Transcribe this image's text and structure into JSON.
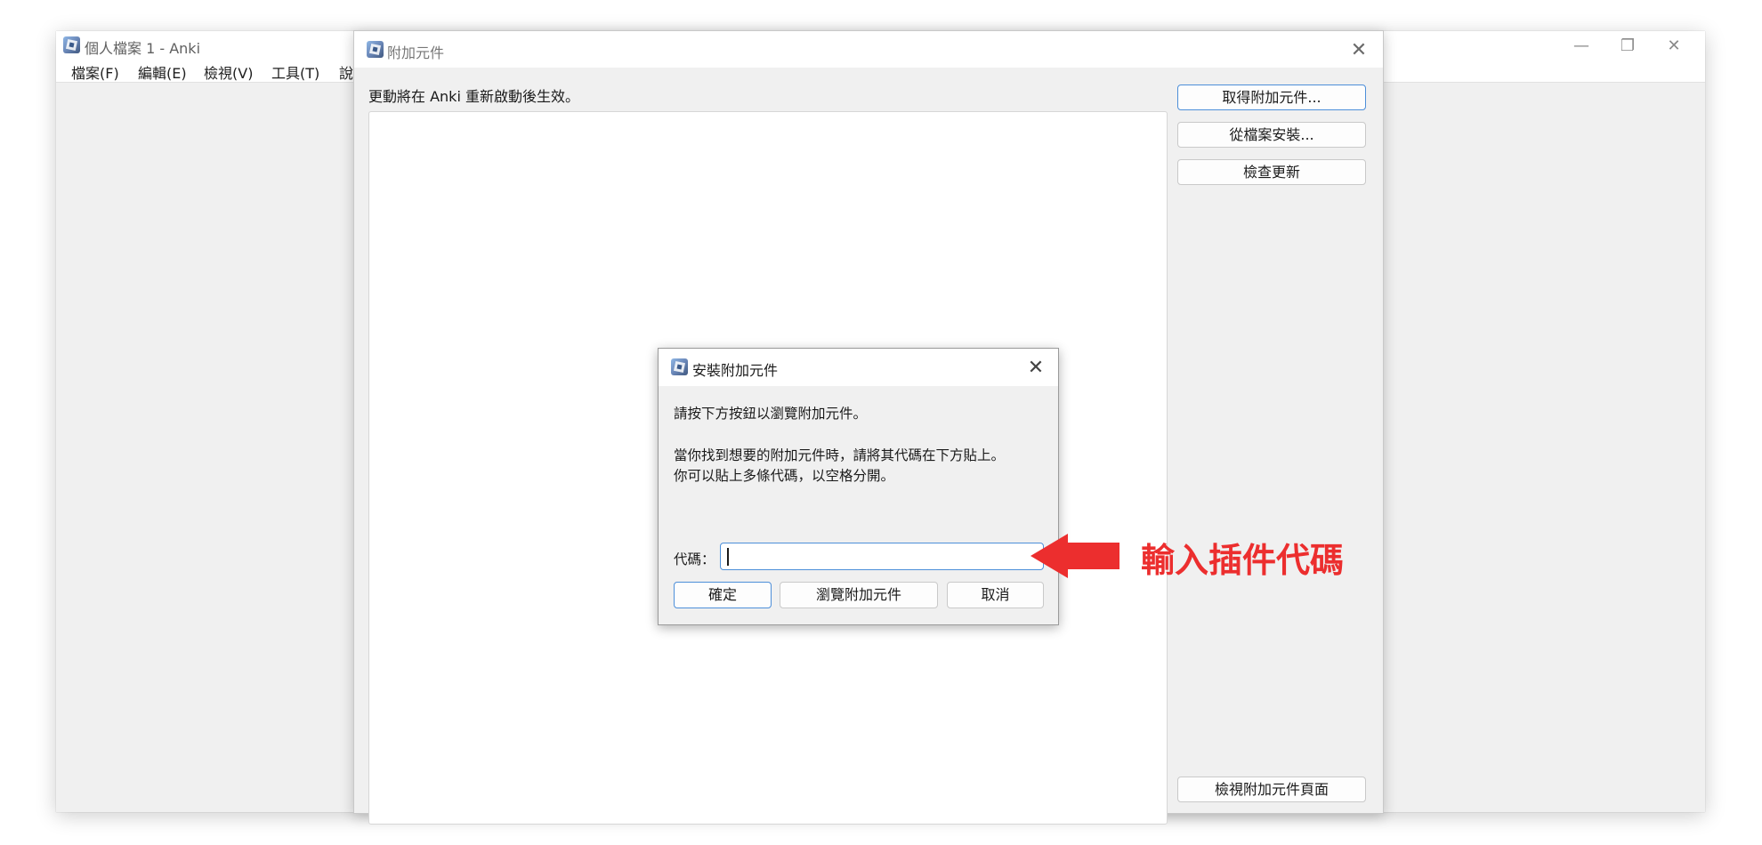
{
  "main_window": {
    "title": "個人檔案 1 - Anki",
    "controls": {
      "minimize": "—",
      "restore": "❐",
      "close": "✕"
    },
    "menu": [
      {
        "label": "檔案(F)"
      },
      {
        "label": "編輯(E)"
      },
      {
        "label": "檢視(V)"
      },
      {
        "label": "工具(T)"
      },
      {
        "label": "說"
      }
    ]
  },
  "addons_window": {
    "title": "附加元件",
    "close": "✕",
    "notice": "更動將在 Anki 重新啟動後生效。",
    "buttons": {
      "get_addons": "取得附加元件...",
      "install_from_file": "從檔案安裝...",
      "check_updates": "檢查更新",
      "view_addon_page": "檢視附加元件頁面"
    }
  },
  "install_dialog": {
    "title": "安裝附加元件",
    "close": "✕",
    "instruction_1": "請按下方按鈕以瀏覽附加元件。",
    "instruction_2": "當你找到想要的附加元件時，請將其代碼在下方貼上。",
    "instruction_3": "你可以貼上多條代碼，以空格分開。",
    "code_label": "代碼：",
    "code_value": "",
    "buttons": {
      "ok": "確定",
      "browse": "瀏覽附加元件",
      "cancel": "取消"
    }
  },
  "annotation": {
    "text": "輸入插件代碼",
    "color": "#ec2e2e"
  },
  "colors": {
    "accent": "#4d8fd9",
    "window_bg": "#f0f0f0",
    "annotation_red": "#ec2e2e"
  }
}
